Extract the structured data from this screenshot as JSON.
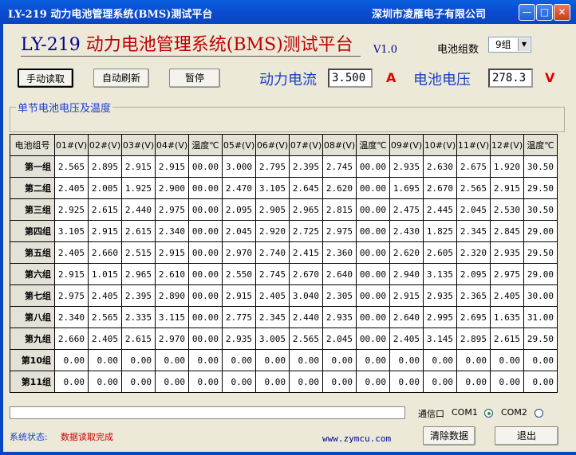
{
  "window": {
    "title": "LY-219 动力电池管理系统(BMS)测试平台",
    "company": "深圳市凌雁电子有限公司"
  },
  "header": {
    "code": "LY-219",
    "title": "动力电池管理系统(BMS)测试平台",
    "version": "V1.0"
  },
  "controls": {
    "manual_read": "手动读取",
    "auto_refresh": "自动刷新",
    "pause": "暂停",
    "group_count_label": "电池组数",
    "group_count_value": "9组"
  },
  "readings": {
    "current_label": "动力电流",
    "current_value": "3.500",
    "current_unit": "A",
    "voltage_label": "电池电压",
    "voltage_value": "278.3",
    "voltage_unit": "V"
  },
  "section_title": "单节电池电压及温度",
  "table": {
    "headers": [
      "电池组号",
      "01#(V)",
      "02#(V)",
      "03#(V)",
      "04#(V)",
      "温度℃",
      "05#(V)",
      "06#(V)",
      "07#(V)",
      "08#(V)",
      "温度℃",
      "09#(V)",
      "10#(V)",
      "11#(V)",
      "12#(V)",
      "温度℃"
    ],
    "rows": [
      [
        "第一组",
        "2.565",
        "2.895",
        "2.915",
        "2.915",
        "00.00",
        "3.000",
        "2.795",
        "2.395",
        "2.745",
        "00.00",
        "2.935",
        "2.630",
        "2.675",
        "1.920",
        "30.50"
      ],
      [
        "第二组",
        "2.405",
        "2.005",
        "1.925",
        "2.900",
        "00.00",
        "2.470",
        "3.105",
        "2.645",
        "2.620",
        "00.00",
        "1.695",
        "2.670",
        "2.565",
        "2.915",
        "29.50"
      ],
      [
        "第三组",
        "2.925",
        "2.615",
        "2.440",
        "2.975",
        "00.00",
        "2.095",
        "2.905",
        "2.965",
        "2.815",
        "00.00",
        "2.475",
        "2.445",
        "2.045",
        "2.530",
        "30.50"
      ],
      [
        "第四组",
        "3.105",
        "2.915",
        "2.615",
        "2.340",
        "00.00",
        "2.045",
        "2.920",
        "2.725",
        "2.975",
        "00.00",
        "2.430",
        "1.825",
        "2.345",
        "2.845",
        "29.00"
      ],
      [
        "第五组",
        "2.405",
        "2.660",
        "2.515",
        "2.915",
        "00.00",
        "2.970",
        "2.740",
        "2.415",
        "2.360",
        "00.00",
        "2.620",
        "2.605",
        "2.320",
        "2.935",
        "29.50"
      ],
      [
        "第六组",
        "2.915",
        "1.015",
        "2.965",
        "2.610",
        "00.00",
        "2.550",
        "2.745",
        "2.670",
        "2.640",
        "00.00",
        "2.940",
        "3.135",
        "2.095",
        "2.975",
        "29.00"
      ],
      [
        "第七组",
        "2.975",
        "2.405",
        "2.395",
        "2.890",
        "00.00",
        "2.915",
        "2.405",
        "3.040",
        "2.305",
        "00.00",
        "2.915",
        "2.935",
        "2.365",
        "2.405",
        "30.00"
      ],
      [
        "第八组",
        "2.340",
        "2.565",
        "2.335",
        "3.115",
        "00.00",
        "2.775",
        "2.345",
        "2.440",
        "2.935",
        "00.00",
        "2.640",
        "2.995",
        "2.695",
        "1.635",
        "31.00"
      ],
      [
        "第九组",
        "2.660",
        "2.405",
        "2.615",
        "2.970",
        "00.00",
        "2.935",
        "3.005",
        "2.565",
        "2.045",
        "00.00",
        "2.405",
        "3.145",
        "2.895",
        "2.615",
        "29.50"
      ],
      [
        "第10组",
        "0.00",
        "0.00",
        "0.00",
        "0.00",
        "0.00",
        "0.00",
        "0.00",
        "0.00",
        "0.00",
        "0.00",
        "0.00",
        "0.00",
        "0.00",
        "0.00",
        "0.00"
      ],
      [
        "第11组",
        "0.00",
        "0.00",
        "0.00",
        "0.00",
        "0.00",
        "0.00",
        "0.00",
        "0.00",
        "0.00",
        "0.00",
        "0.00",
        "0.00",
        "0.00",
        "0.00",
        "0.00"
      ]
    ]
  },
  "footer": {
    "port_label": "通信口",
    "com1": "COM1",
    "com2": "COM2",
    "selected_port": "COM1",
    "status_label": "系统状态:",
    "status_text": "数据读取完成",
    "url": "www.zymcu.com",
    "clear_button": "清除数据",
    "exit_button": "退出"
  }
}
